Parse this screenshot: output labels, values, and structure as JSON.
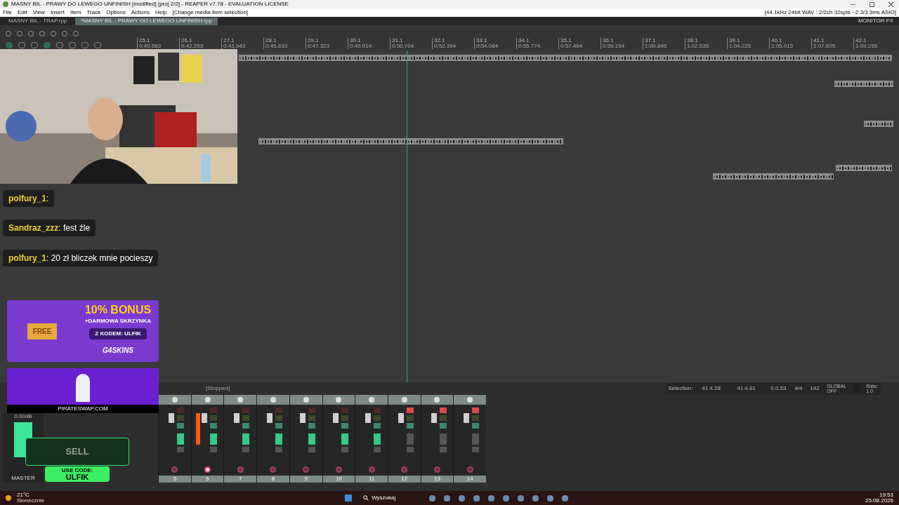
{
  "window": {
    "title": "MASNY BIL - PRAWY DO LEWEGO UNFINISH [modified] [proj 2/2] - REAPER v7.78 - EVALUATION LICENSE"
  },
  "menu": [
    "File",
    "Edit",
    "View",
    "Insert",
    "Item",
    "Track",
    "Options",
    "Actions",
    "Help"
  ],
  "menu_hint": "[Change media item selection]",
  "audio_info": "[44.1kHz 24bit WAV : 2/2ch 32spls ~2.3/3.3ms ASIO]",
  "project_tabs": [
    {
      "label": "MASNY BIL - TRAP.rpp",
      "selected": false
    },
    {
      "label": "*MASNY BIL - PRAWY DO LEWEGO UNFINISH.rpp",
      "selected": true
    }
  ],
  "monitor_fx": "MONITOR FX",
  "ruler": [
    {
      "bar": "25.1",
      "time": "0:40.563"
    },
    {
      "bar": "26.1",
      "time": "0:42.253"
    },
    {
      "bar": "27.1",
      "time": "0:43.943"
    },
    {
      "bar": "28.1",
      "time": "0:45.633"
    },
    {
      "bar": "29.1",
      "time": "0:47.323"
    },
    {
      "bar": "30.1",
      "time": "0:49.014"
    },
    {
      "bar": "31.1",
      "time": "0:50.704"
    },
    {
      "bar": "32.1",
      "time": "0:52.394"
    },
    {
      "bar": "33.1",
      "time": "0:54.084"
    },
    {
      "bar": "34.1",
      "time": "0:55.774"
    },
    {
      "bar": "35.1",
      "time": "0:57.464"
    },
    {
      "bar": "36.1",
      "time": "0:59.154"
    },
    {
      "bar": "37.1",
      "time": "1:00.845"
    },
    {
      "bar": "38.1",
      "time": "1:02.535"
    },
    {
      "bar": "39.1",
      "time": "1:04.225"
    },
    {
      "bar": "40.1",
      "time": "1:05.915"
    },
    {
      "bar": "41.1",
      "time": "1:07.605"
    },
    {
      "bar": "42.1",
      "time": "1:09.295"
    }
  ],
  "chat": [
    {
      "user": "polfury_1",
      "sep": ":"
    },
    {
      "user": "Sandraz_zzz",
      "sep": ":",
      "text": "fest źle"
    },
    {
      "user": "polfury_1",
      "sep": ":",
      "text": "20 zł bliczek mnie pocieszy"
    }
  ],
  "ad_g4": {
    "bonus": "10% BONUS",
    "line": "+DARMOWA SKRZYNKA",
    "code": "Z KODEM: ULFIK",
    "brand": "G4SKINS",
    "chest": "FREE"
  },
  "ad_pirate": {
    "site": "PIRATESWAP.COM"
  },
  "ad_sell": {
    "title": "SELL",
    "code_label": "USE CODE:",
    "code": "ULFIK"
  },
  "transport": {
    "state": "[Stopped]",
    "selection_label": "Selection:",
    "start": "41.4.28",
    "end": "41.4.81",
    "length": "0.0.53",
    "signature": "4/4",
    "tempo": "142",
    "automation": "GLOBAL",
    "automation_state": "OFF",
    "rate_label": "Rate:",
    "rate": "1.0"
  },
  "master": {
    "label": "MASTER",
    "reading": "0.00dB"
  },
  "strips": [
    {
      "number": "5",
      "muted": false,
      "fx_on": true,
      "armed": false
    },
    {
      "number": "6",
      "muted": false,
      "fx_on": true,
      "armed": true
    },
    {
      "number": "7",
      "muted": false,
      "fx_on": true,
      "armed": false
    },
    {
      "number": "8",
      "muted": false,
      "fx_on": true,
      "armed": false
    },
    {
      "number": "9",
      "muted": false,
      "fx_on": true,
      "armed": false
    },
    {
      "number": "10",
      "muted": false,
      "fx_on": true,
      "armed": false
    },
    {
      "number": "11",
      "muted": false,
      "fx_on": true,
      "armed": false
    },
    {
      "number": "12",
      "muted": true,
      "fx_on": false,
      "armed": false
    },
    {
      "number": "13",
      "muted": true,
      "fx_on": false,
      "armed": false
    },
    {
      "number": "14",
      "muted": true,
      "fx_on": false,
      "armed": false
    }
  ],
  "taskbar": {
    "temp": "21°C",
    "weather": "Słonecznie",
    "search": "Wyszukaj",
    "time": "19:53",
    "date": "25.08.2026"
  }
}
